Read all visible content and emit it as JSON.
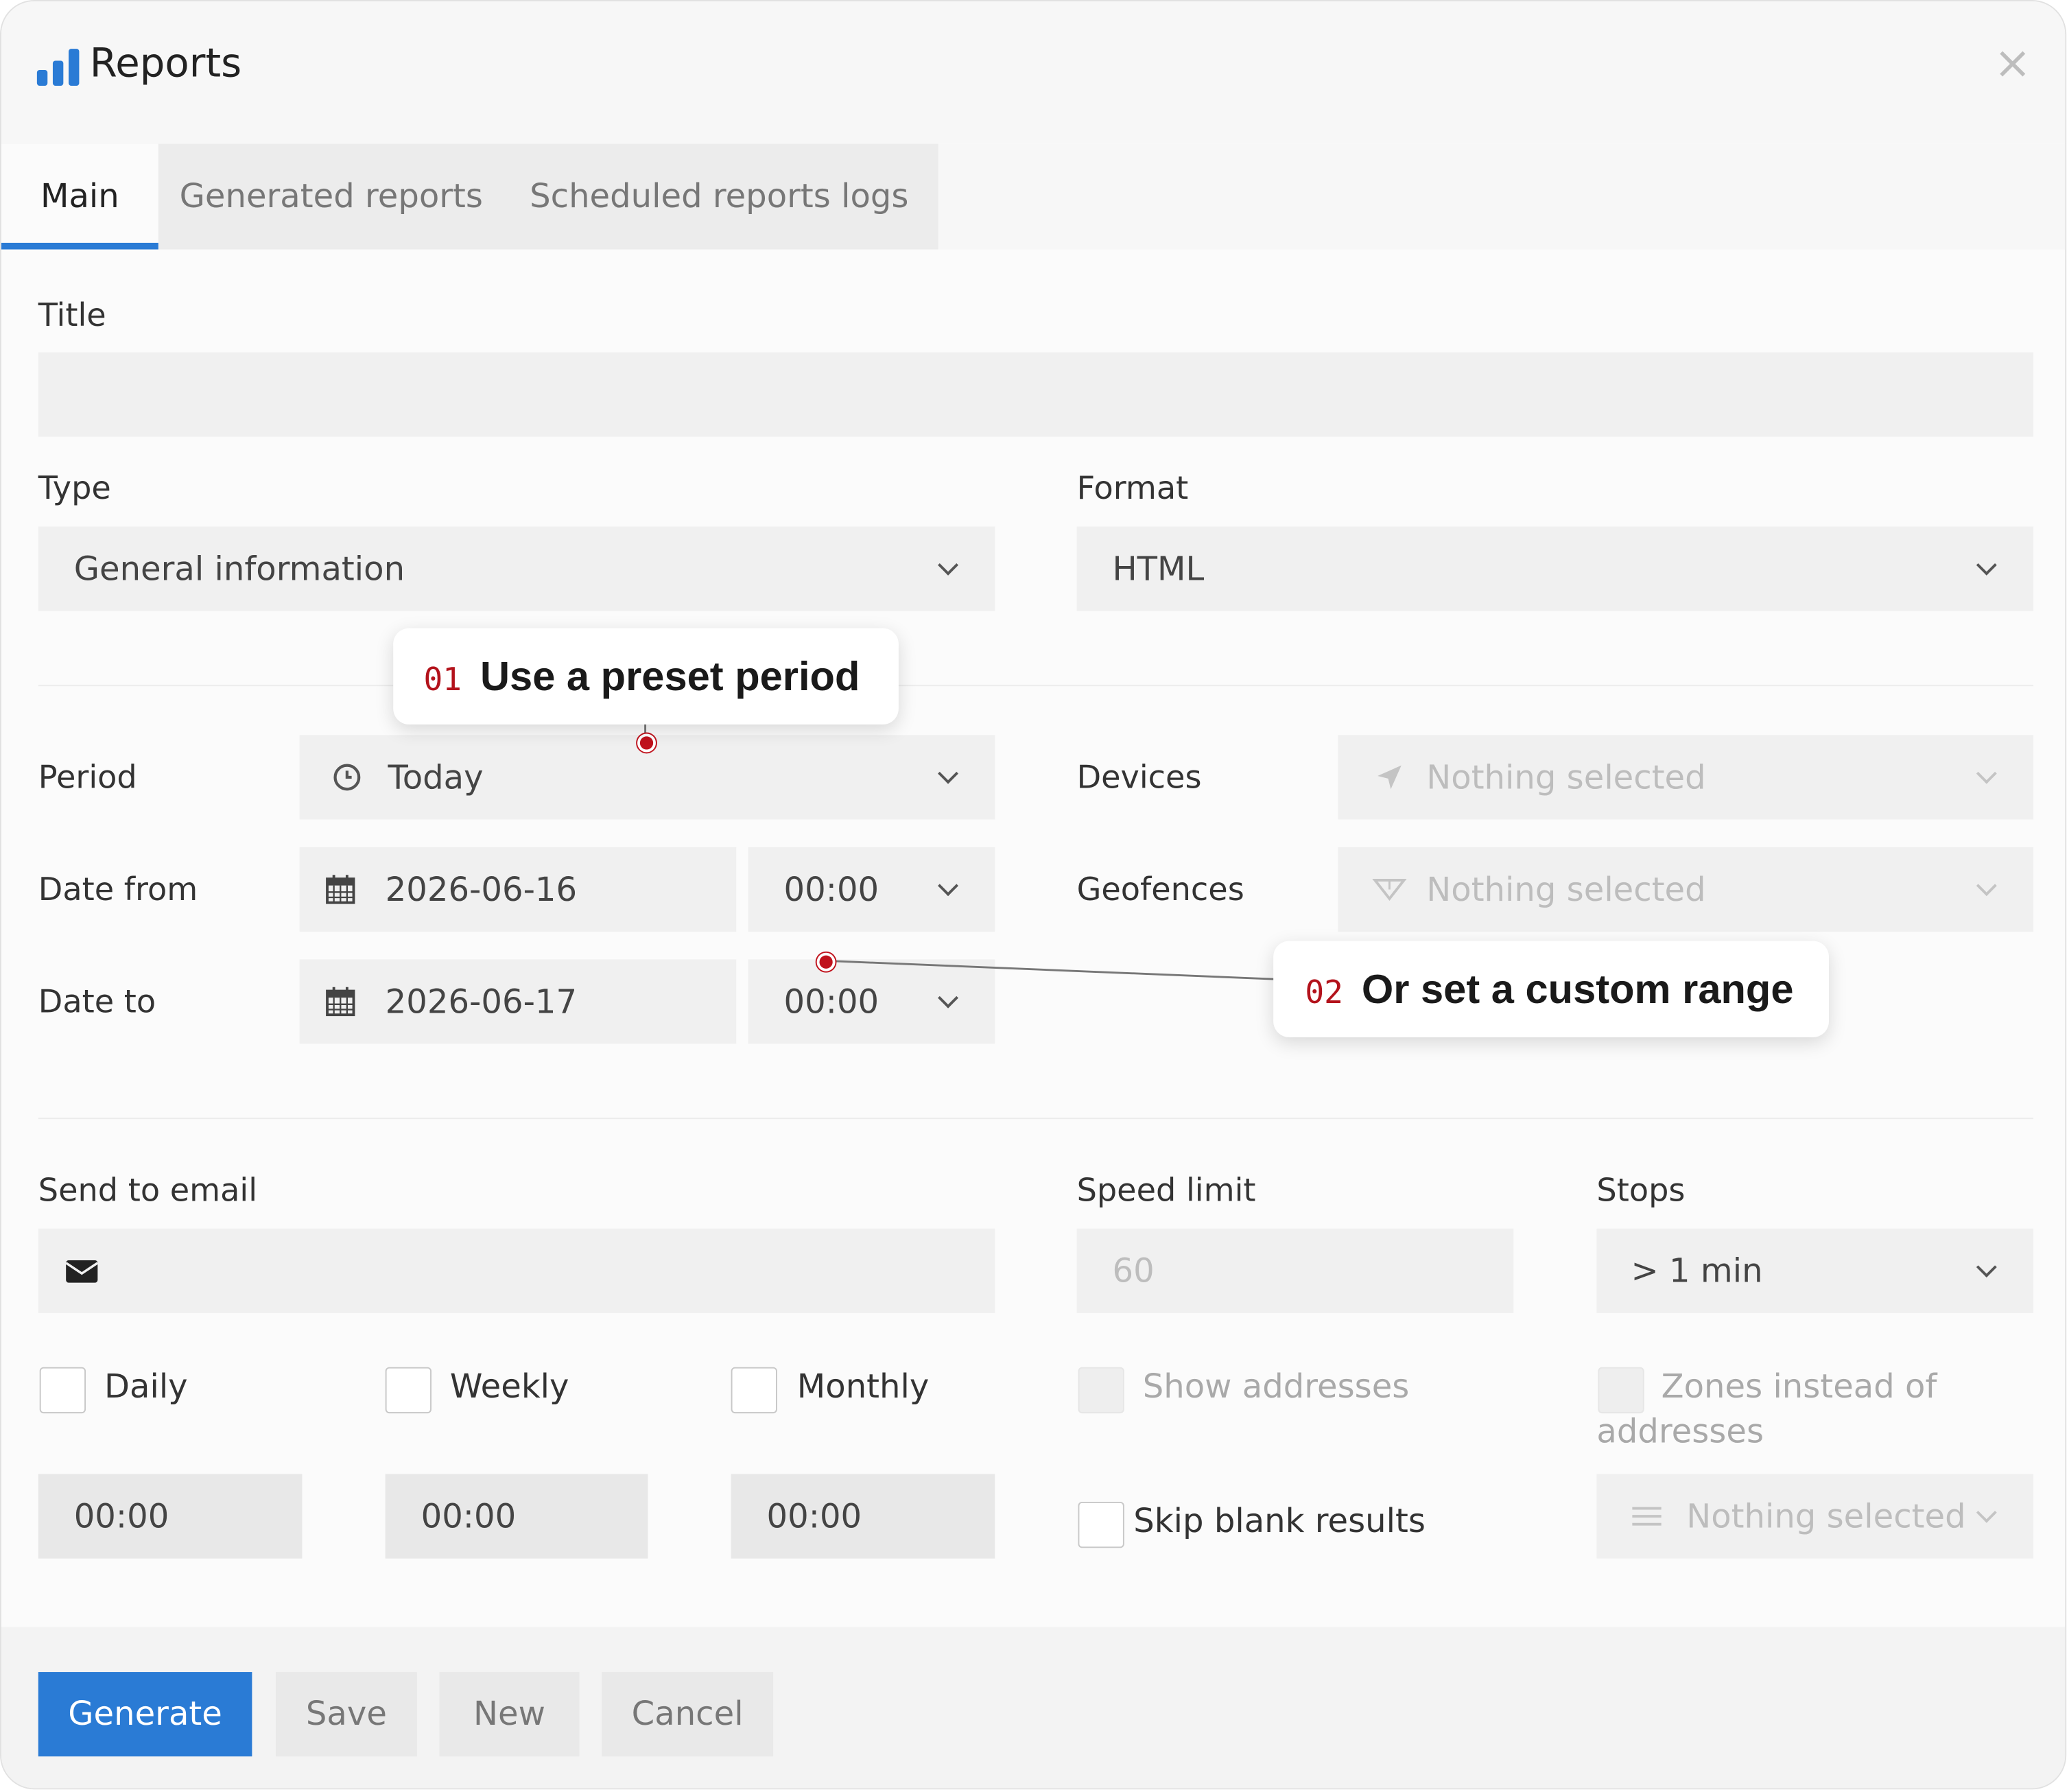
{
  "app": {
    "title": "Reports",
    "icon": "bar-chart-icon",
    "close_icon": "×"
  },
  "tabs": [
    {
      "label": "Main",
      "active": true
    },
    {
      "label": "Generated reports",
      "active": false
    },
    {
      "label": "Scheduled reports logs",
      "active": false
    }
  ],
  "form": {
    "title_label": "Title",
    "title_value": "",
    "type_label": "Type",
    "type_value": "General information",
    "format_label": "Format",
    "format_value": "HTML",
    "period_label": "Period",
    "period_value": "Today",
    "date_from_label": "Date from",
    "date_from_value": "2026-06-16",
    "date_from_time": "00:00",
    "date_to_label": "Date to",
    "date_to_value": "2026-06-17",
    "date_to_time": "00:00",
    "devices_label": "Devices",
    "devices_value": "Nothing selected",
    "geofences_label": "Geofences",
    "geofences_value": "Nothing selected",
    "send_email_label": "Send to email",
    "send_email_value": "",
    "speed_limit_label": "Speed limit",
    "speed_limit_placeholder": "60",
    "stops_label": "Stops",
    "stops_value": "> 1 min",
    "daily_label": "Daily",
    "weekly_label": "Weekly",
    "monthly_label": "Monthly",
    "daily_time": "00:00",
    "weekly_time": "00:00",
    "monthly_time": "00:00",
    "show_addresses_label": "Show addresses",
    "zones_label": "Zones instead of addresses",
    "skip_blank_label": "Skip blank results",
    "zones_select_value": "Nothing selected"
  },
  "buttons": {
    "generate": "Generate",
    "save": "Save",
    "new": "New",
    "cancel": "Cancel"
  },
  "callouts": [
    {
      "num": "01",
      "text": "Use a preset period"
    },
    {
      "num": "02",
      "text": "Or set a custom range"
    }
  ],
  "colors": {
    "accent": "#2a7bd5",
    "callout_marker": "#c0121c",
    "field_bg": "#f0f0f0"
  }
}
